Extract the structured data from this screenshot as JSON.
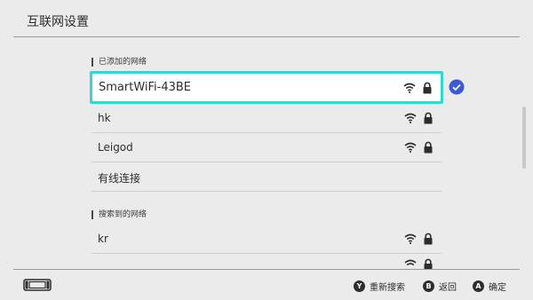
{
  "header": {
    "title": "互联网设置"
  },
  "sections": {
    "added": {
      "label": "已添加的网络"
    },
    "found": {
      "label": "搜索到的网络"
    }
  },
  "added_networks": [
    {
      "name": "SmartWiFi-43BE",
      "selected": true,
      "connected": true,
      "wifi": true,
      "locked": true
    },
    {
      "name": "hk",
      "wifi": true,
      "locked": true
    },
    {
      "name": "Leigod",
      "wifi": true,
      "locked": true
    },
    {
      "name": "有线连接",
      "wifi": false,
      "locked": false
    }
  ],
  "found_networks": [
    {
      "name": "kr",
      "wifi": true,
      "locked": true
    }
  ],
  "footer": {
    "search": {
      "key": "Y",
      "label": "重新搜索"
    },
    "back": {
      "key": "B",
      "label": "返回"
    },
    "confirm": {
      "key": "A",
      "label": "确定"
    }
  },
  "colors": {
    "accent": "#38d6cf",
    "check": "#3a5bd6",
    "background": "#ebebeb"
  }
}
